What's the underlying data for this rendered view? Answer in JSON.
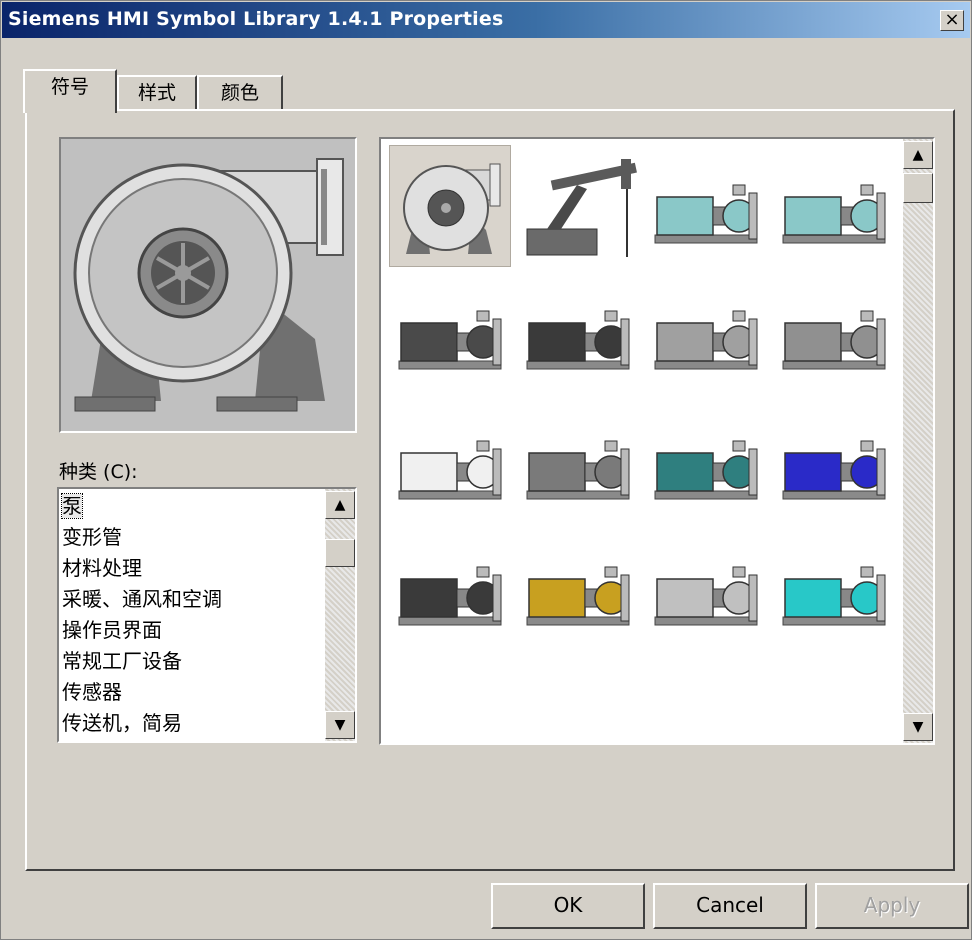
{
  "window": {
    "title": "Siemens HMI Symbol Library 1.4.1 Properties",
    "close_glyph": "×"
  },
  "tabs": [
    {
      "label": "符号",
      "active": true
    },
    {
      "label": "样式",
      "active": false
    },
    {
      "label": "颜色",
      "active": false
    }
  ],
  "category": {
    "label": "种类 (C):",
    "items": [
      "泵",
      "变形管",
      "材料处理",
      "采暖、通风和空调",
      "操作员界面",
      "常规工厂设备",
      "传感器",
      "传送机，简易"
    ],
    "selected": "泵"
  },
  "scroll": {
    "up_glyph": "▲",
    "down_glyph": "▼"
  },
  "symbols": [
    {
      "name": "centrifugal-blower-pump",
      "selected": true,
      "color": "#a8a8a8"
    },
    {
      "name": "pumpjack",
      "selected": false,
      "color": "#5a5a5a"
    },
    {
      "name": "horizontal-pump-motor",
      "selected": false,
      "color": "#8ac8c8"
    },
    {
      "name": "horizontal-pump-motor-2",
      "selected": false,
      "color": "#8ac8c8"
    },
    {
      "name": "motor-block",
      "selected": false,
      "color": "#4a4a4a"
    },
    {
      "name": "motor-inline-pump",
      "selected": false,
      "color": "#3a3a3a"
    },
    {
      "name": "skid-pump",
      "selected": false,
      "color": "#a0a0a0"
    },
    {
      "name": "close-coupled-pump",
      "selected": false,
      "color": "#909090"
    },
    {
      "name": "white-motor-pump",
      "selected": false,
      "color": "#f0f0f0"
    },
    {
      "name": "grey-frame-pump",
      "selected": false,
      "color": "#7a7a7a"
    },
    {
      "name": "teal-pump",
      "selected": false,
      "color": "#2f7f7f"
    },
    {
      "name": "blue-pump",
      "selected": false,
      "color": "#2a2ac8"
    },
    {
      "name": "long-shaft-pump",
      "selected": false,
      "color": "#3a3a3a"
    },
    {
      "name": "yellow-shaft-pump",
      "selected": false,
      "color": "#c8a020"
    },
    {
      "name": "silver-pump",
      "selected": false,
      "color": "#c0c0c0"
    },
    {
      "name": "cyan-split-case-pump",
      "selected": false,
      "color": "#28c8c8"
    }
  ],
  "buttons": {
    "ok": "OK",
    "cancel": "Cancel",
    "apply": "Apply"
  },
  "colors": {
    "face": "#d4d0c8",
    "title_start": "#0a246a",
    "title_end": "#a6caf0"
  }
}
